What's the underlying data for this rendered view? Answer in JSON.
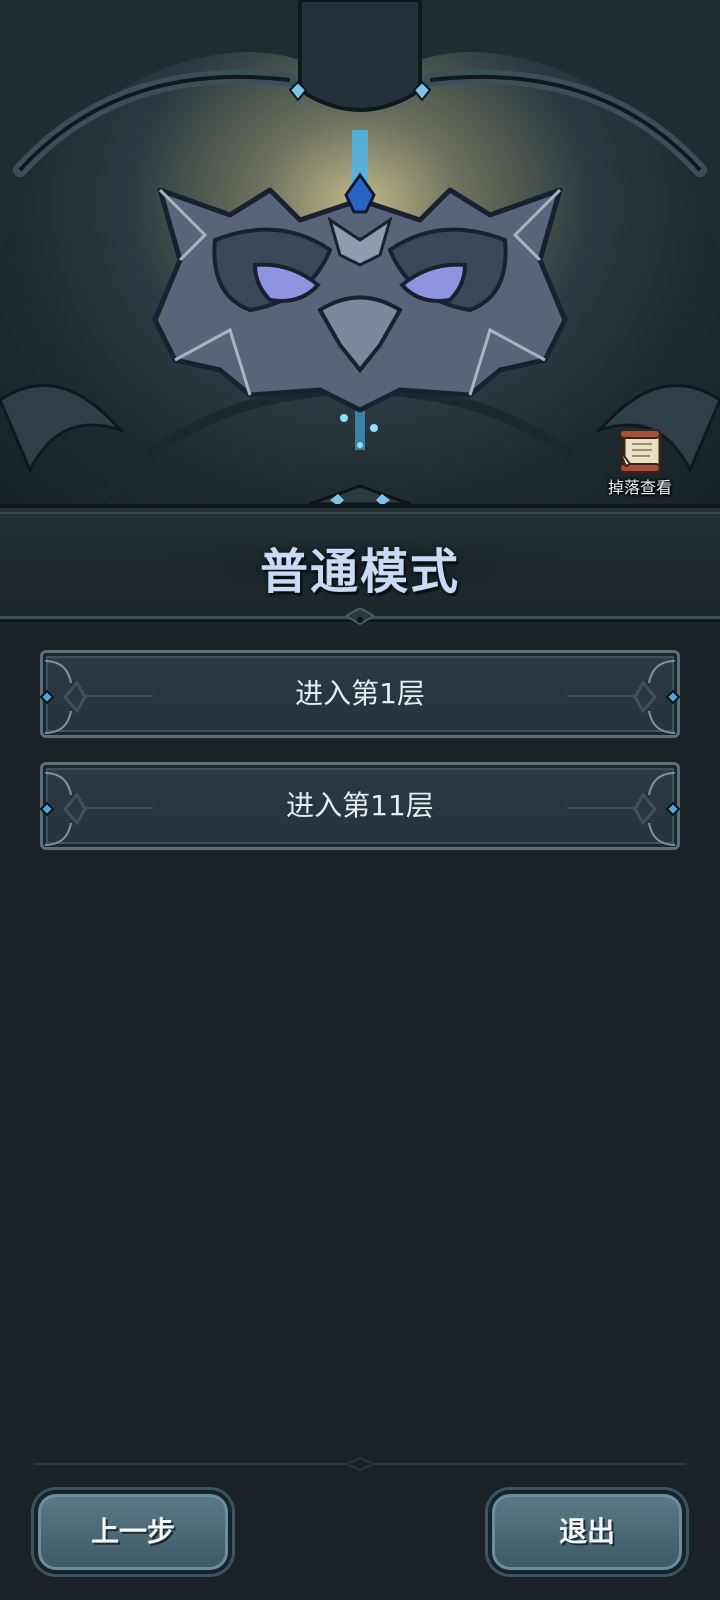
{
  "hero": {
    "boss_icon": "owl-mask-boss-emblem",
    "drop_view": {
      "icon": "scroll-quill-icon",
      "label": "掉落查看"
    }
  },
  "mode": {
    "title": "普通模式"
  },
  "floors": [
    {
      "label": "进入第1层"
    },
    {
      "label": "进入第11层"
    }
  ],
  "nav": {
    "back_label": "上一步",
    "exit_label": "退出"
  },
  "colors": {
    "title": "#c9daf5",
    "background": "#1a2227",
    "button_accent": "#4aa8e0"
  }
}
